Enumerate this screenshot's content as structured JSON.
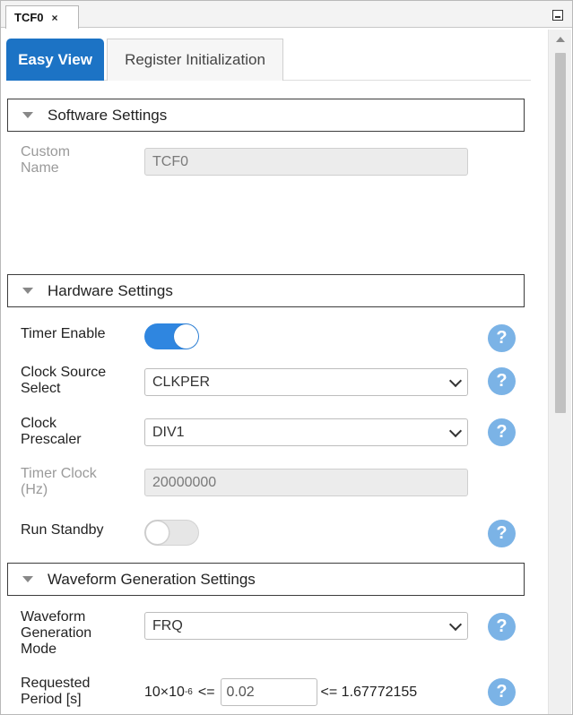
{
  "tabstrip": {
    "tab_label": "TCF0",
    "close_glyph": "×"
  },
  "view_tabs": {
    "active": "Easy View",
    "inactive": "Register Initialization"
  },
  "software_settings": {
    "title": "Software Settings",
    "custom_name": {
      "label_line1": "Custom",
      "label_line2": "Name",
      "value": "TCF0"
    }
  },
  "hardware_settings": {
    "title": "Hardware Settings",
    "timer_enable": {
      "label": "Timer Enable",
      "state": "on"
    },
    "clock_source": {
      "label_line1": "Clock Source",
      "label_line2": "Select",
      "value": "CLKPER"
    },
    "clock_prescaler": {
      "label_line1": "Clock",
      "label_line2": "Prescaler",
      "value": "DIV1"
    },
    "timer_clock": {
      "label_line1": "Timer Clock",
      "label_line2": "(Hz)",
      "value": "20000000"
    },
    "run_standby": {
      "label": "Run Standby",
      "state": "off"
    }
  },
  "waveform_settings": {
    "title": "Waveform Generation Settings",
    "mode": {
      "label_line1": "Waveform",
      "label_line2": "Generation",
      "label_line3": "Mode",
      "value": "FRQ"
    },
    "period": {
      "label_line1": "Requested",
      "label_line2": "Period [s]",
      "min_base": "10×10",
      "min_exp": "-6",
      "min_op": "<=",
      "value": "0.02",
      "max_text": "<= 1.67772155"
    }
  },
  "help_glyph": "?",
  "colors": {
    "accent": "#1c73c5",
    "help": "#7bb3e6",
    "toggle_on": "#2f86e0"
  }
}
